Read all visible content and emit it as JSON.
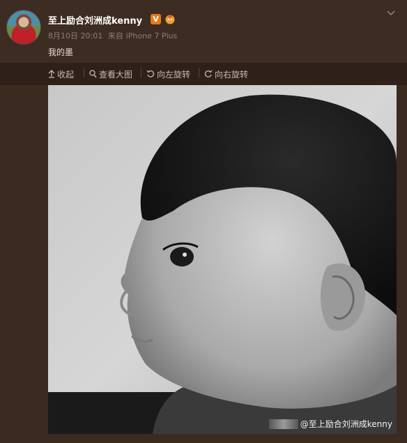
{
  "post": {
    "username": "至上励合刘洲成kenny",
    "verified_badge": "V",
    "date": "8月10日 20:01",
    "source_prefix": "来自",
    "source": "iPhone 7 Plus",
    "text": "我的墨"
  },
  "toolbar": {
    "collapse_label": "收起",
    "view_large_label": "查看大图",
    "rotate_left_label": "向左旋转",
    "rotate_right_label": "向右旋转"
  },
  "image": {
    "watermark_text": "@至上励合刘洲成kenny"
  },
  "colors": {
    "background": "#2c1f17",
    "badge": "#e8761a"
  },
  "icons": [
    "avatar",
    "verified-v-icon",
    "member-icon",
    "chevron-down-icon",
    "collapse-icon",
    "search-icon",
    "rotate-left-icon",
    "rotate-right-icon"
  ]
}
